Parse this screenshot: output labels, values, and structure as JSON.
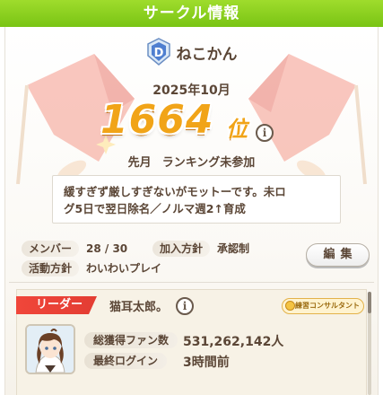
{
  "header": {
    "title": "サークル情報"
  },
  "club": {
    "name": "ねこかん",
    "rank_letter": "D",
    "date": "2025年10月",
    "rank": "1664",
    "rank_unit": "位",
    "last_month_label": "先月",
    "ranking_status": "ランキング未参加",
    "motto_line1": "緩すぎず厳しすぎないがモットーです。未ロ",
    "motto_line2": "グ5日で翌日除名／ノルマ週2↑育成"
  },
  "info": {
    "members_label": "メンバー",
    "members_value": "28 / 30",
    "join_label": "加入方針",
    "join_value": "承認制",
    "activity_label": "活動方針",
    "activity_value": "わいわいプレイ",
    "edit_label": "編集"
  },
  "leader": {
    "tag": "リーダー",
    "name": "猫耳太郎。",
    "consultant": "練習コンサルタント",
    "fans_label": "総獲得ファン数",
    "fans_value": "531,262,142人",
    "login_label": "最終ログイン",
    "login_value": "3時間前"
  },
  "icons": {
    "info": "info-icon",
    "rank_badge": "rank-d-badge-icon",
    "consultant": "consultant-icon",
    "decorative": "laurel-flag-decoration"
  },
  "colors": {
    "header_green": "#8fd023",
    "rank_gold": "#f1a418",
    "leader_red": "#e33d33",
    "text_brown": "#5b4636"
  }
}
